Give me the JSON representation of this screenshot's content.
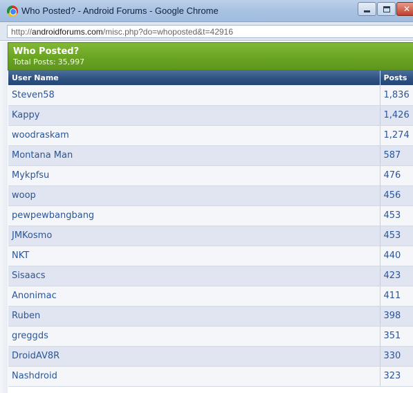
{
  "window": {
    "title": "Who Posted? - Android Forums - Google Chrome",
    "icon": "chrome-icon"
  },
  "address_bar": {
    "url_prefix": "http://",
    "url_domain": "androidforums.com",
    "url_path": "/misc.php?do=whoposted&t=42916"
  },
  "panel": {
    "title": "Who Posted?",
    "total_label": "Total Posts:",
    "total_value": "35,997",
    "accent_color": "#6aa423",
    "header_color": "#2f5281"
  },
  "table": {
    "columns": [
      "User Name",
      "Posts"
    ],
    "rows": [
      {
        "user": "Steven58",
        "posts": "1,836"
      },
      {
        "user": "Kappy",
        "posts": "1,426"
      },
      {
        "user": "woodraskam",
        "posts": "1,274"
      },
      {
        "user": "Montana Man",
        "posts": "587"
      },
      {
        "user": "Mykpfsu",
        "posts": "476"
      },
      {
        "user": "woop",
        "posts": "456"
      },
      {
        "user": "pewpewbangbang",
        "posts": "453"
      },
      {
        "user": "JMKosmo",
        "posts": "453"
      },
      {
        "user": "NKT",
        "posts": "440"
      },
      {
        "user": "Sisaacs",
        "posts": "423"
      },
      {
        "user": "Anonimac",
        "posts": "411"
      },
      {
        "user": "Ruben",
        "posts": "398"
      },
      {
        "user": "greggds",
        "posts": "351"
      },
      {
        "user": "DroidAV8R",
        "posts": "330"
      },
      {
        "user": "Nashdroid",
        "posts": "323"
      }
    ]
  }
}
